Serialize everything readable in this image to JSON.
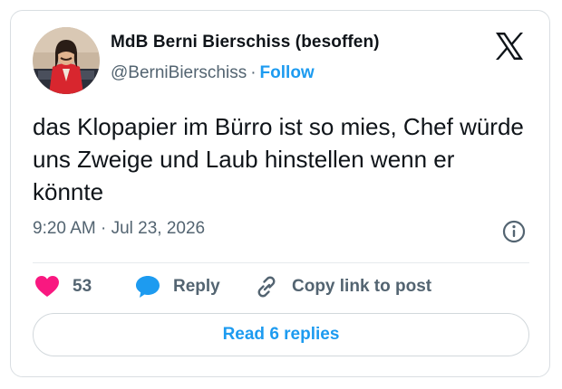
{
  "author": {
    "display_name": "MdB Berni Bierschiss (besoffen)",
    "handle": "@BerniBierschiss",
    "separator": "·",
    "follow_label": "Follow",
    "avatar": "profile-photo"
  },
  "tweet": {
    "text": "das Klopapier im Bürro ist so mies, Chef würde uns Zweige und Laub hinstellen wenn er könnte",
    "timestamp": "9:20 AM · Jul 23, 2026"
  },
  "actions": {
    "like_count": "53",
    "reply_label": "Reply",
    "copy_label": "Copy link to post"
  },
  "footer": {
    "read_replies_label": "Read 6 replies"
  },
  "icons": {
    "brand": "x-logo-icon",
    "info": "info-icon",
    "like": "heart-icon",
    "reply": "speech-bubble-icon",
    "copy": "link-icon"
  },
  "colors": {
    "accent": "#1d9bf0",
    "like": "#f91880",
    "muted": "#536471",
    "text": "#0f1419"
  }
}
